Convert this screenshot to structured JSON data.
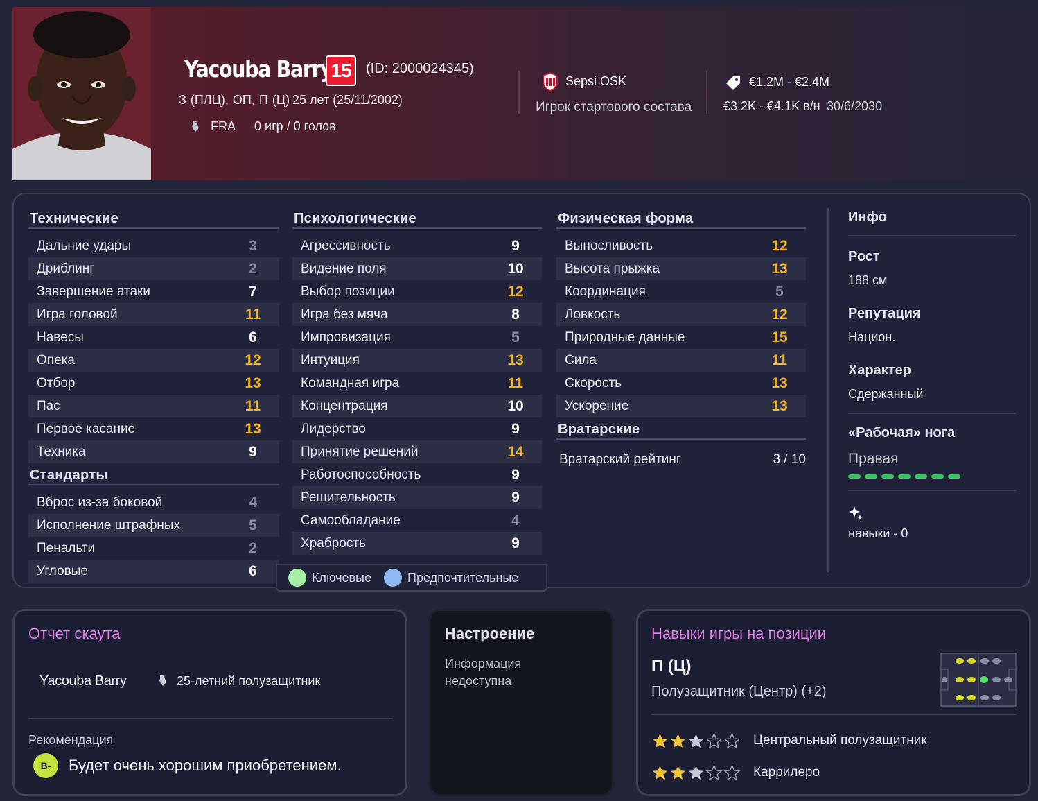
{
  "player": {
    "name": "Yacouba Barry",
    "number": "15",
    "id_text": "(ID: 2000024345)",
    "positions": "З (ПЛЦ), ОП, П (Ц)",
    "age_text": "25 лет (25/11/2002)",
    "nationality": "FRA",
    "apps_text": "0 игр / 0 голов"
  },
  "club": {
    "name": "Sepsi OSK",
    "role": "Игрок стартового состава"
  },
  "finance": {
    "value": "€1.2M - €2.4M",
    "wage": "€3.2K - €4.1K  в/н",
    "contract_end": "30/6/2030"
  },
  "attributes": {
    "technical": {
      "title": "Технические",
      "items": [
        {
          "label": "Дальние удары",
          "value": "3",
          "tone": "gray"
        },
        {
          "label": "Дриблинг",
          "value": "2",
          "tone": "gray"
        },
        {
          "label": "Завершение атаки",
          "value": "7",
          "tone": "white"
        },
        {
          "label": "Игра головой",
          "value": "11",
          "tone": "gold"
        },
        {
          "label": "Навесы",
          "value": "6",
          "tone": "white"
        },
        {
          "label": "Опека",
          "value": "12",
          "tone": "gold"
        },
        {
          "label": "Отбор",
          "value": "13",
          "tone": "gold"
        },
        {
          "label": "Пас",
          "value": "11",
          "tone": "gold"
        },
        {
          "label": "Первое касание",
          "value": "13",
          "tone": "gold"
        },
        {
          "label": "Техника",
          "value": "9",
          "tone": "white"
        }
      ]
    },
    "set_pieces": {
      "title": "Стандарты",
      "items": [
        {
          "label": "Вброс из-за боковой",
          "value": "4",
          "tone": "gray"
        },
        {
          "label": "Исполнение штрафных",
          "value": "5",
          "tone": "gray"
        },
        {
          "label": "Пенальти",
          "value": "2",
          "tone": "gray"
        },
        {
          "label": "Угловые",
          "value": "6",
          "tone": "white"
        }
      ]
    },
    "mental": {
      "title": "Психологические",
      "items": [
        {
          "label": "Агрессивность",
          "value": "9",
          "tone": "white"
        },
        {
          "label": "Видение поля",
          "value": "10",
          "tone": "white"
        },
        {
          "label": "Выбор позиции",
          "value": "12",
          "tone": "gold"
        },
        {
          "label": "Игра без мяча",
          "value": "8",
          "tone": "white"
        },
        {
          "label": "Импровизация",
          "value": "5",
          "tone": "gray"
        },
        {
          "label": "Интуиция",
          "value": "13",
          "tone": "gold"
        },
        {
          "label": "Командная игра",
          "value": "11",
          "tone": "gold"
        },
        {
          "label": "Концентрация",
          "value": "10",
          "tone": "white"
        },
        {
          "label": "Лидерство",
          "value": "9",
          "tone": "white"
        },
        {
          "label": "Принятие решений",
          "value": "14",
          "tone": "gold"
        },
        {
          "label": "Работоспособность",
          "value": "9",
          "tone": "white"
        },
        {
          "label": "Решительность",
          "value": "9",
          "tone": "white"
        },
        {
          "label": "Самообладание",
          "value": "4",
          "tone": "gray"
        },
        {
          "label": "Храбрость",
          "value": "9",
          "tone": "white"
        }
      ]
    },
    "physical": {
      "title": "Физическая форма",
      "items": [
        {
          "label": "Выносливость",
          "value": "12",
          "tone": "gold"
        },
        {
          "label": "Высота прыжка",
          "value": "13",
          "tone": "gold"
        },
        {
          "label": "Координация",
          "value": "5",
          "tone": "gray"
        },
        {
          "label": "Ловкость",
          "value": "12",
          "tone": "gold"
        },
        {
          "label": "Природные данные",
          "value": "15",
          "tone": "gold"
        },
        {
          "label": "Сила",
          "value": "11",
          "tone": "gold"
        },
        {
          "label": "Скорость",
          "value": "13",
          "tone": "gold"
        },
        {
          "label": "Ускорение",
          "value": "13",
          "tone": "gold"
        }
      ]
    },
    "goalkeeping": {
      "title": "Вратарские",
      "rating_label": "Вратарский рейтинг",
      "rating_value": "3 / 10"
    }
  },
  "legend": {
    "key": "Ключевые",
    "preferred": "Предпочтительные",
    "key_color": "#a6eea6",
    "preferred_color": "#8fb8f4"
  },
  "info": {
    "title": "Инфо",
    "height_label": "Рост",
    "height_value": "188 см",
    "reputation_label": "Репутация",
    "reputation_value": "Национ.",
    "personality_label": "Характер",
    "personality_value": "Сдержанный",
    "foot_label": "«Рабочая» нога",
    "foot_value": "Правая",
    "foot_level": 1.0,
    "traits_text": "навыки - 0"
  },
  "scout": {
    "title": "Отчет скаута",
    "player_name": "Yacouba Barry",
    "description": "25-летний полузащитник",
    "recommendation_label": "Рекомендация",
    "grade": "B-",
    "recommendation": "Будет очень хорошим приобретением."
  },
  "mood": {
    "title": "Настроение",
    "text": "Информация недоступна"
  },
  "position_skills": {
    "title": "Навыки игры на позиции",
    "position_code": "П (Ц)",
    "position_name": "Полузащитник (Центр) (+2)",
    "roles": [
      {
        "name": "Центральный полузащитник",
        "stars": 3
      },
      {
        "name": "Каррилеро",
        "stars": 3
      }
    ]
  }
}
